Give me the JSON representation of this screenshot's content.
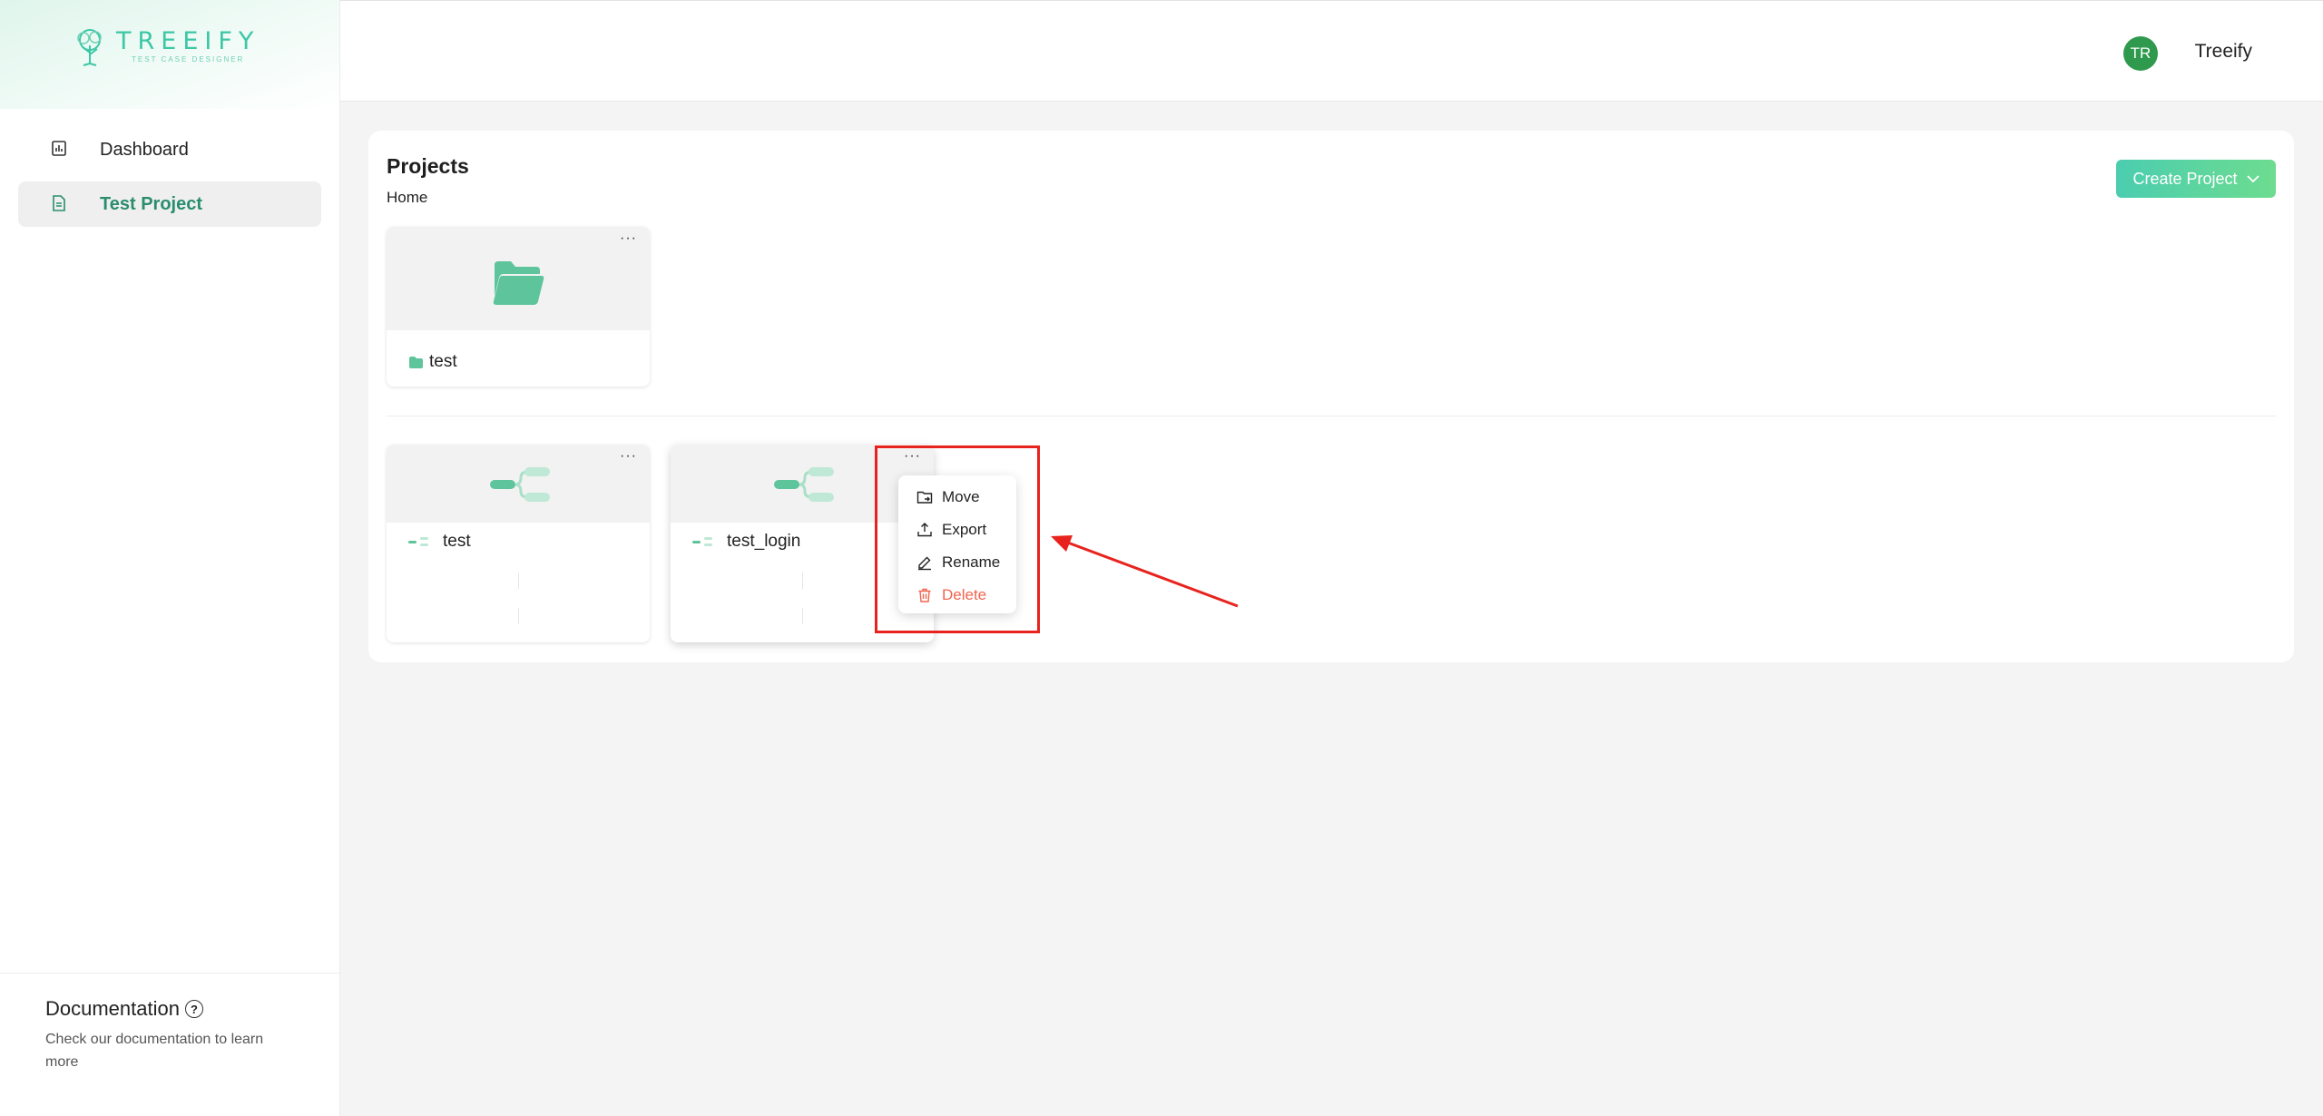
{
  "brand": {
    "name": "TREEIFY",
    "tagline": "TEST CASE DESIGNER",
    "accent": "#3cc7a5"
  },
  "sidebar": {
    "items": [
      {
        "label": "Dashboard",
        "icon": "chart-icon",
        "active": false
      },
      {
        "label": "Test Project",
        "icon": "document-icon",
        "active": true
      }
    ],
    "documentation": {
      "title": "Documentation",
      "description": "Check our documentation to learn more"
    }
  },
  "header": {
    "avatar_initials": "TR",
    "user_name": "Treeify",
    "avatar_color": "#2f9a4e"
  },
  "main": {
    "title": "Projects",
    "breadcrumb": "Home",
    "create_button": "Create Project",
    "folders": [
      {
        "name": "test",
        "more": "···"
      }
    ],
    "mindmaps": [
      {
        "name": "test",
        "more": "···"
      },
      {
        "name": "test_login",
        "more": "···"
      }
    ]
  },
  "context_menu": {
    "items": [
      {
        "label": "Move",
        "icon": "folder-move-icon"
      },
      {
        "label": "Export",
        "icon": "export-icon"
      },
      {
        "label": "Rename",
        "icon": "edit-icon"
      },
      {
        "label": "Delete",
        "icon": "trash-icon",
        "color": "#f0654f"
      }
    ]
  },
  "annotation": {
    "highlight_color": "#e8231d"
  }
}
